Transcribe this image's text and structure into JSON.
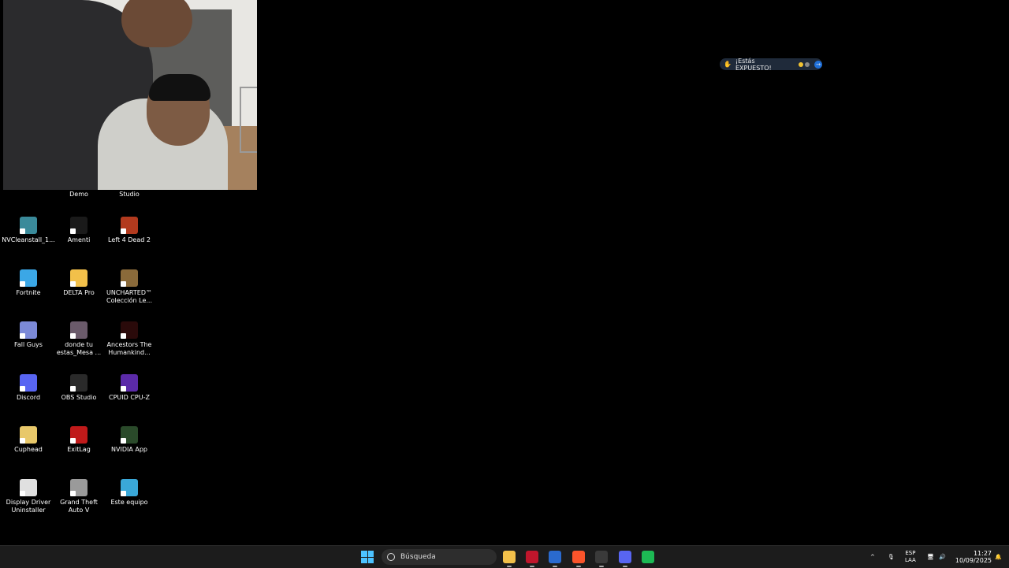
{
  "desktop": {
    "top_labels": [
      "Demo",
      "Studio"
    ],
    "icons": [
      {
        "name": "nvcleanstall-icon",
        "label": "NVCleanstall_1...",
        "color": "#3a8a9a"
      },
      {
        "name": "amenti-icon",
        "label": "Amenti",
        "color": "#1a1a1a"
      },
      {
        "name": "left4dead2-icon",
        "label": "Left 4 Dead 2",
        "color": "#b23a1e"
      },
      {
        "name": "fortnite-icon",
        "label": "Fortnite",
        "color": "#3ba7e6"
      },
      {
        "name": "folder-icon",
        "label": "DELTA Pro",
        "color": "#f2c04a"
      },
      {
        "name": "uncharted-icon",
        "label": "UNCHARTED™ Colección Le...",
        "color": "#8a6a3a"
      },
      {
        "name": "fallguys-icon",
        "label": "Fall Guys",
        "color": "#7c8ad8"
      },
      {
        "name": "image-file-icon",
        "label": "donde tu estas_Mesa ...",
        "color": "#6a5a6a"
      },
      {
        "name": "ancestors-icon",
        "label": "Ancestors The Humankind...",
        "color": "#2a0a0a"
      },
      {
        "name": "discord-icon",
        "label": "Discord",
        "color": "#5865f2"
      },
      {
        "name": "obs-icon",
        "label": "OBS Studio",
        "color": "#2a2a2a"
      },
      {
        "name": "cpuz-icon",
        "label": "CPUID CPU-Z",
        "color": "#5b2aa8"
      },
      {
        "name": "cuphead-icon",
        "label": "Cuphead",
        "color": "#e8c86a"
      },
      {
        "name": "exitlag-icon",
        "label": "ExitLag",
        "color": "#c01a1a"
      },
      {
        "name": "nvidia-app-icon",
        "label": "NVIDIA App",
        "color": "#2a4a2a"
      },
      {
        "name": "ddu-icon",
        "label": "Display Driver Uninstaller",
        "color": "#e0e0e0"
      },
      {
        "name": "gta5-icon",
        "label": "Grand Theft Auto V",
        "color": "#9a9a9a"
      },
      {
        "name": "this-pc-icon",
        "label": "Este equipo",
        "color": "#3aa8d8"
      }
    ]
  },
  "notification": {
    "text": "¡Estás EXPUESTO!"
  },
  "taskbar": {
    "search_placeholder": "Búsqueda",
    "apps": [
      {
        "name": "file-explorer-icon",
        "color": "#f2c04a"
      },
      {
        "name": "opera-gx-icon",
        "color": "#c0162c"
      },
      {
        "name": "shield-app-icon",
        "color": "#2a6acf"
      },
      {
        "name": "brave-browser-icon",
        "color": "#fb542b"
      },
      {
        "name": "obs-taskbar-icon",
        "color": "#3a3a3a"
      },
      {
        "name": "discord-taskbar-icon",
        "color": "#5865f2"
      },
      {
        "name": "spotify-icon",
        "color": "#1db954"
      }
    ],
    "lang_line1": "ESP",
    "lang_line2": "LAA",
    "time": "11:27",
    "date": "10/09/2025"
  }
}
